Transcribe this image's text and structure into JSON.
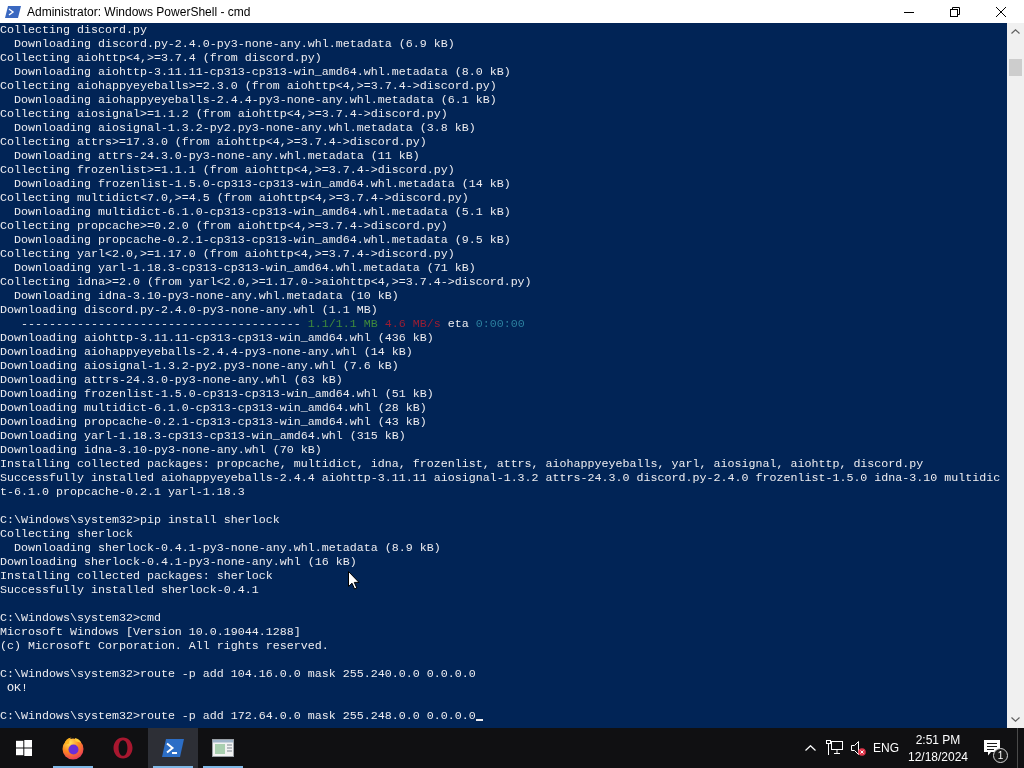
{
  "window": {
    "title": "Administrator: Windows PowerShell - cmd"
  },
  "console": {
    "blocks": [
      {
        "lines": [
          {
            "kind": "text",
            "text": "Collecting discord.py"
          },
          {
            "kind": "text",
            "text": "  Downloading discord.py-2.4.0-py3-none-any.whl.metadata (6.9 kB)"
          },
          {
            "kind": "text",
            "text": "Collecting aiohttp<4,>=3.7.4 (from discord.py)"
          },
          {
            "kind": "text",
            "text": "  Downloading aiohttp-3.11.11-cp313-cp313-win_amd64.whl.metadata (8.0 kB)"
          },
          {
            "kind": "text",
            "text": "Collecting aiohappyeyeballs>=2.3.0 (from aiohttp<4,>=3.7.4->discord.py)"
          },
          {
            "kind": "text",
            "text": "  Downloading aiohappyeyeballs-2.4.4-py3-none-any.whl.metadata (6.1 kB)"
          },
          {
            "kind": "text",
            "text": "Collecting aiosignal>=1.1.2 (from aiohttp<4,>=3.7.4->discord.py)"
          },
          {
            "kind": "text",
            "text": "  Downloading aiosignal-1.3.2-py2.py3-none-any.whl.metadata (3.8 kB)"
          },
          {
            "kind": "text",
            "text": "Collecting attrs>=17.3.0 (from aiohttp<4,>=3.7.4->discord.py)"
          },
          {
            "kind": "text",
            "text": "  Downloading attrs-24.3.0-py3-none-any.whl.metadata (11 kB)"
          },
          {
            "kind": "text",
            "text": "Collecting frozenlist>=1.1.1 (from aiohttp<4,>=3.7.4->discord.py)"
          },
          {
            "kind": "text",
            "text": "  Downloading frozenlist-1.5.0-cp313-cp313-win_amd64.whl.metadata (14 kB)"
          },
          {
            "kind": "text",
            "text": "Collecting multidict<7.0,>=4.5 (from aiohttp<4,>=3.7.4->discord.py)"
          },
          {
            "kind": "text",
            "text": "  Downloading multidict-6.1.0-cp313-cp313-win_amd64.whl.metadata (5.1 kB)"
          },
          {
            "kind": "text",
            "text": "Collecting propcache>=0.2.0 (from aiohttp<4,>=3.7.4->discord.py)"
          },
          {
            "kind": "text",
            "text": "  Downloading propcache-0.2.1-cp313-cp313-win_amd64.whl.metadata (9.5 kB)"
          },
          {
            "kind": "text",
            "text": "Collecting yarl<2.0,>=1.17.0 (from aiohttp<4,>=3.7.4->discord.py)"
          },
          {
            "kind": "text",
            "text": "  Downloading yarl-1.18.3-cp313-cp313-win_amd64.whl.metadata (71 kB)"
          },
          {
            "kind": "text",
            "text": "Collecting idna>=2.0 (from yarl<2.0,>=1.17.0->aiohttp<4,>=3.7.4->discord.py)"
          },
          {
            "kind": "text",
            "text": "  Downloading idna-3.10-py3-none-any.whl.metadata (10 kB)"
          },
          {
            "kind": "text",
            "text": "Downloading discord.py-2.4.0-py3-none-any.whl (1.1 MB)"
          },
          {
            "kind": "progress",
            "segments": [
              {
                "text": "   ----------------------------------------"
              },
              {
                "text": "1.1/1.1 MB",
                "color": "#3f8a3c"
              },
              {
                "text": "4.6 MB/s",
                "color": "#9a1d33"
              },
              {
                "text": "eta"
              },
              {
                "text": "0:00:00",
                "color": "#2b7f9e"
              }
            ]
          },
          {
            "kind": "text",
            "text": "Downloading aiohttp-3.11.11-cp313-cp313-win_amd64.whl (436 kB)"
          },
          {
            "kind": "text",
            "text": "Downloading aiohappyeyeballs-2.4.4-py3-none-any.whl (14 kB)"
          },
          {
            "kind": "text",
            "text": "Downloading aiosignal-1.3.2-py2.py3-none-any.whl (7.6 kB)"
          },
          {
            "kind": "text",
            "text": "Downloading attrs-24.3.0-py3-none-any.whl (63 kB)"
          },
          {
            "kind": "text",
            "text": "Downloading frozenlist-1.5.0-cp313-cp313-win_amd64.whl (51 kB)"
          },
          {
            "kind": "text",
            "text": "Downloading multidict-6.1.0-cp313-cp313-win_amd64.whl (28 kB)"
          },
          {
            "kind": "text",
            "text": "Downloading propcache-0.2.1-cp313-cp313-win_amd64.whl (43 kB)"
          },
          {
            "kind": "text",
            "text": "Downloading yarl-1.18.3-cp313-cp313-win_amd64.whl (315 kB)"
          },
          {
            "kind": "text",
            "text": "Downloading idna-3.10-py3-none-any.whl (70 kB)"
          },
          {
            "kind": "text",
            "text": "Installing collected packages: propcache, multidict, idna, frozenlist, attrs, aiohappyeyeballs, yarl, aiosignal, aiohttp, discord.py"
          },
          {
            "kind": "text",
            "text": "Successfully installed aiohappyeyeballs-2.4.4 aiohttp-3.11.11 aiosignal-1.3.2 attrs-24.3.0 discord.py-2.4.0 frozenlist-1.5.0 idna-3.10 multidic"
          },
          {
            "kind": "text",
            "text": "t-6.1.0 propcache-0.2.1 yarl-1.18.3"
          }
        ]
      },
      {
        "lines": [
          {
            "kind": "text",
            "text": "C:\\Windows\\system32>pip install sherlock"
          },
          {
            "kind": "text",
            "text": "Collecting sherlock"
          },
          {
            "kind": "text",
            "text": "  Downloading sherlock-0.4.1-py3-none-any.whl.metadata (8.9 kB)"
          },
          {
            "kind": "text",
            "text": "Downloading sherlock-0.4.1-py3-none-any.whl (16 kB)"
          },
          {
            "kind": "text",
            "text": "Installing collected packages: sherlock"
          },
          {
            "kind": "text",
            "text": "Successfully installed sherlock-0.4.1"
          }
        ]
      },
      {
        "lines": [
          {
            "kind": "text",
            "text": "C:\\Windows\\system32>cmd"
          },
          {
            "kind": "text",
            "text": "Microsoft Windows [Version 10.0.19044.1288]"
          },
          {
            "kind": "text",
            "text": "(c) Microsoft Corporation. All rights reserved."
          }
        ]
      },
      {
        "lines": [
          {
            "kind": "text",
            "text": "C:\\Windows\\system32>route -p add 104.16.0.0 mask 255.240.0.0 0.0.0.0"
          },
          {
            "kind": "text",
            "text": " OK!"
          }
        ]
      },
      {
        "lines": [
          {
            "kind": "text",
            "text": "C:\\Windows\\system32>route -p add 172.64.0.0 mask 255.248.0.0 0.0.0.0"
          }
        ]
      }
    ],
    "cursor": true
  },
  "taskbar": {
    "apps": [
      {
        "kind": "flame",
        "running": true,
        "selected": false
      },
      {
        "kind": "ring",
        "running": false,
        "selected": false
      },
      {
        "kind": "prompt",
        "running": true,
        "selected": true
      },
      {
        "kind": "window",
        "running": true,
        "selected": false
      }
    ],
    "tray": {
      "volume_muted": true,
      "language": "ENG",
      "time": "2:51 PM",
      "date": "12/18/2024",
      "notifications": "1"
    }
  }
}
